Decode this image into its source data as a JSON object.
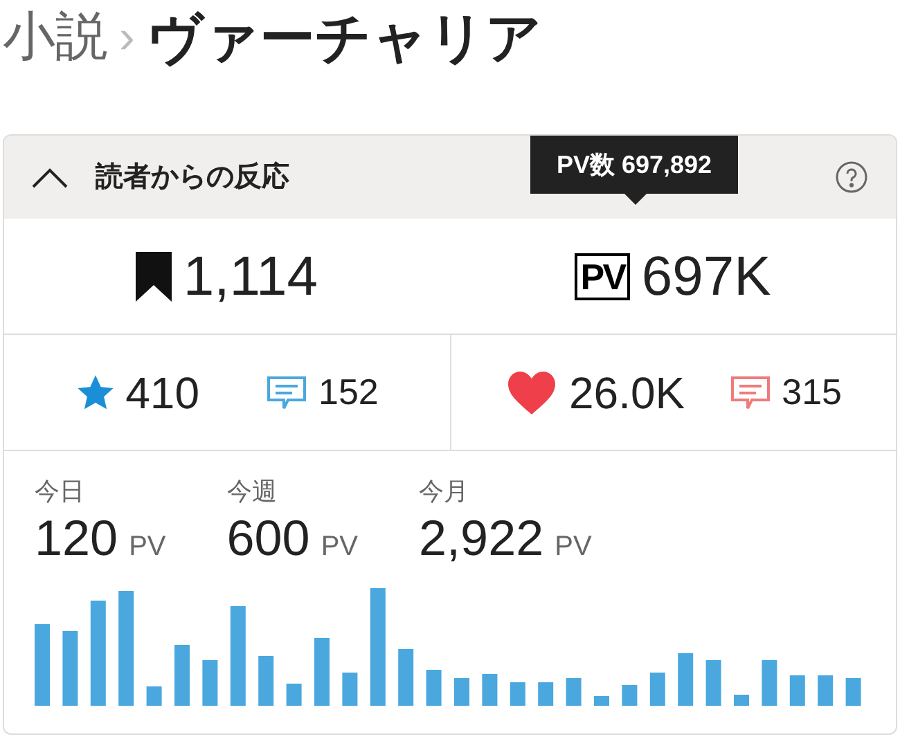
{
  "breadcrumb": {
    "parent": "小説",
    "separator": "›",
    "title": "ヴァーチャリア"
  },
  "panel": {
    "title": "読者からの反応",
    "expanded": true,
    "tooltip": "PV数 697,892",
    "top_stats": [
      {
        "kind": "bookmark",
        "value": "1,114"
      },
      {
        "kind": "pv",
        "badge": "PV",
        "value": "697K"
      }
    ],
    "groups": [
      [
        {
          "kind": "star",
          "value": "410"
        },
        {
          "kind": "comment",
          "color": "#4aa8df",
          "value": "152"
        }
      ],
      [
        {
          "kind": "heart",
          "value": "26.0K"
        },
        {
          "kind": "comment",
          "color": "#f07b7b",
          "value": "315"
        }
      ]
    ],
    "periods": [
      {
        "label": "今日",
        "value": "120",
        "unit": "PV"
      },
      {
        "label": "今週",
        "value": "600",
        "unit": "PV"
      },
      {
        "label": "今月",
        "value": "2,922",
        "unit": "PV"
      }
    ]
  }
}
